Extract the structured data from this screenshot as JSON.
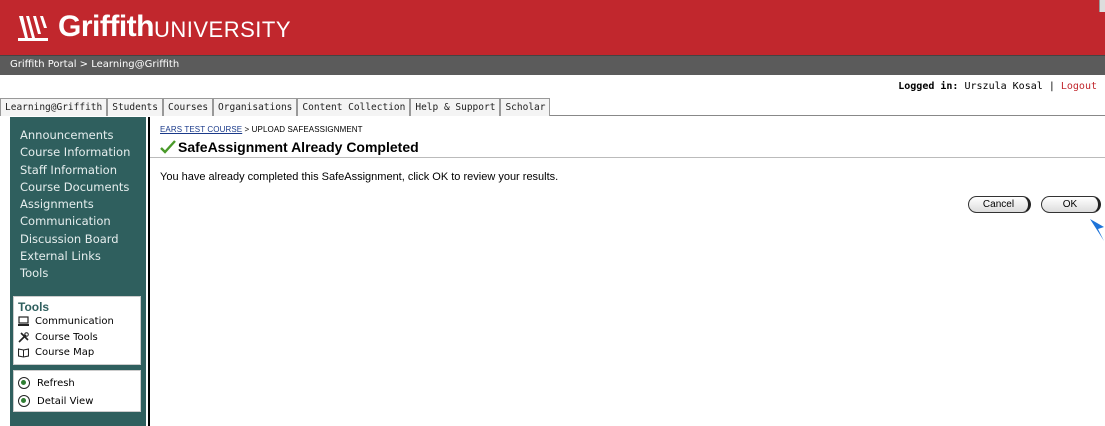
{
  "header": {
    "brand": "Griffith",
    "brand_suffix": "UNIVERSITY",
    "portal_path": "Griffith Portal > Learning@Griffith",
    "brand_color": "#c1272d"
  },
  "session": {
    "logged_in_label": "Logged in:",
    "user": "Urszula Kosal",
    "separator": "|",
    "logout": "Logout"
  },
  "tabs": [
    {
      "label": "Learning@Griffith"
    },
    {
      "label": "Students"
    },
    {
      "label": "Courses"
    },
    {
      "label": "Organisations"
    },
    {
      "label": "Content Collection"
    },
    {
      "label": "Help & Support"
    },
    {
      "label": "Scholar"
    }
  ],
  "sidebar": {
    "items": [
      {
        "label": "Announcements"
      },
      {
        "label": "Course Information"
      },
      {
        "label": "Staff Information"
      },
      {
        "label": "Course Documents"
      },
      {
        "label": "Assignments"
      },
      {
        "label": "Communication"
      },
      {
        "label": "Discussion Board"
      },
      {
        "label": "External Links"
      },
      {
        "label": "Tools"
      }
    ],
    "tools_title": "Tools",
    "tools": [
      {
        "label": "Communication",
        "icon": "monitor-icon"
      },
      {
        "label": "Course Tools",
        "icon": "tools-icon"
      },
      {
        "label": "Course Map",
        "icon": "map-icon"
      }
    ],
    "views": [
      {
        "label": "Refresh",
        "icon": "refresh-icon"
      },
      {
        "label": "Detail View",
        "icon": "detail-view-icon"
      }
    ],
    "bg_color": "#2f5f5e"
  },
  "main": {
    "breadcrumb_course": "EARS TEST COURSE",
    "breadcrumb_sep": " > ",
    "breadcrumb_page": "UPLOAD SAFEASSIGNMENT",
    "title": "SafeAssignment Already Completed",
    "message": "You have already completed this SafeAssignment, click OK to review your results.",
    "cancel_label": "Cancel",
    "ok_label": "OK"
  }
}
